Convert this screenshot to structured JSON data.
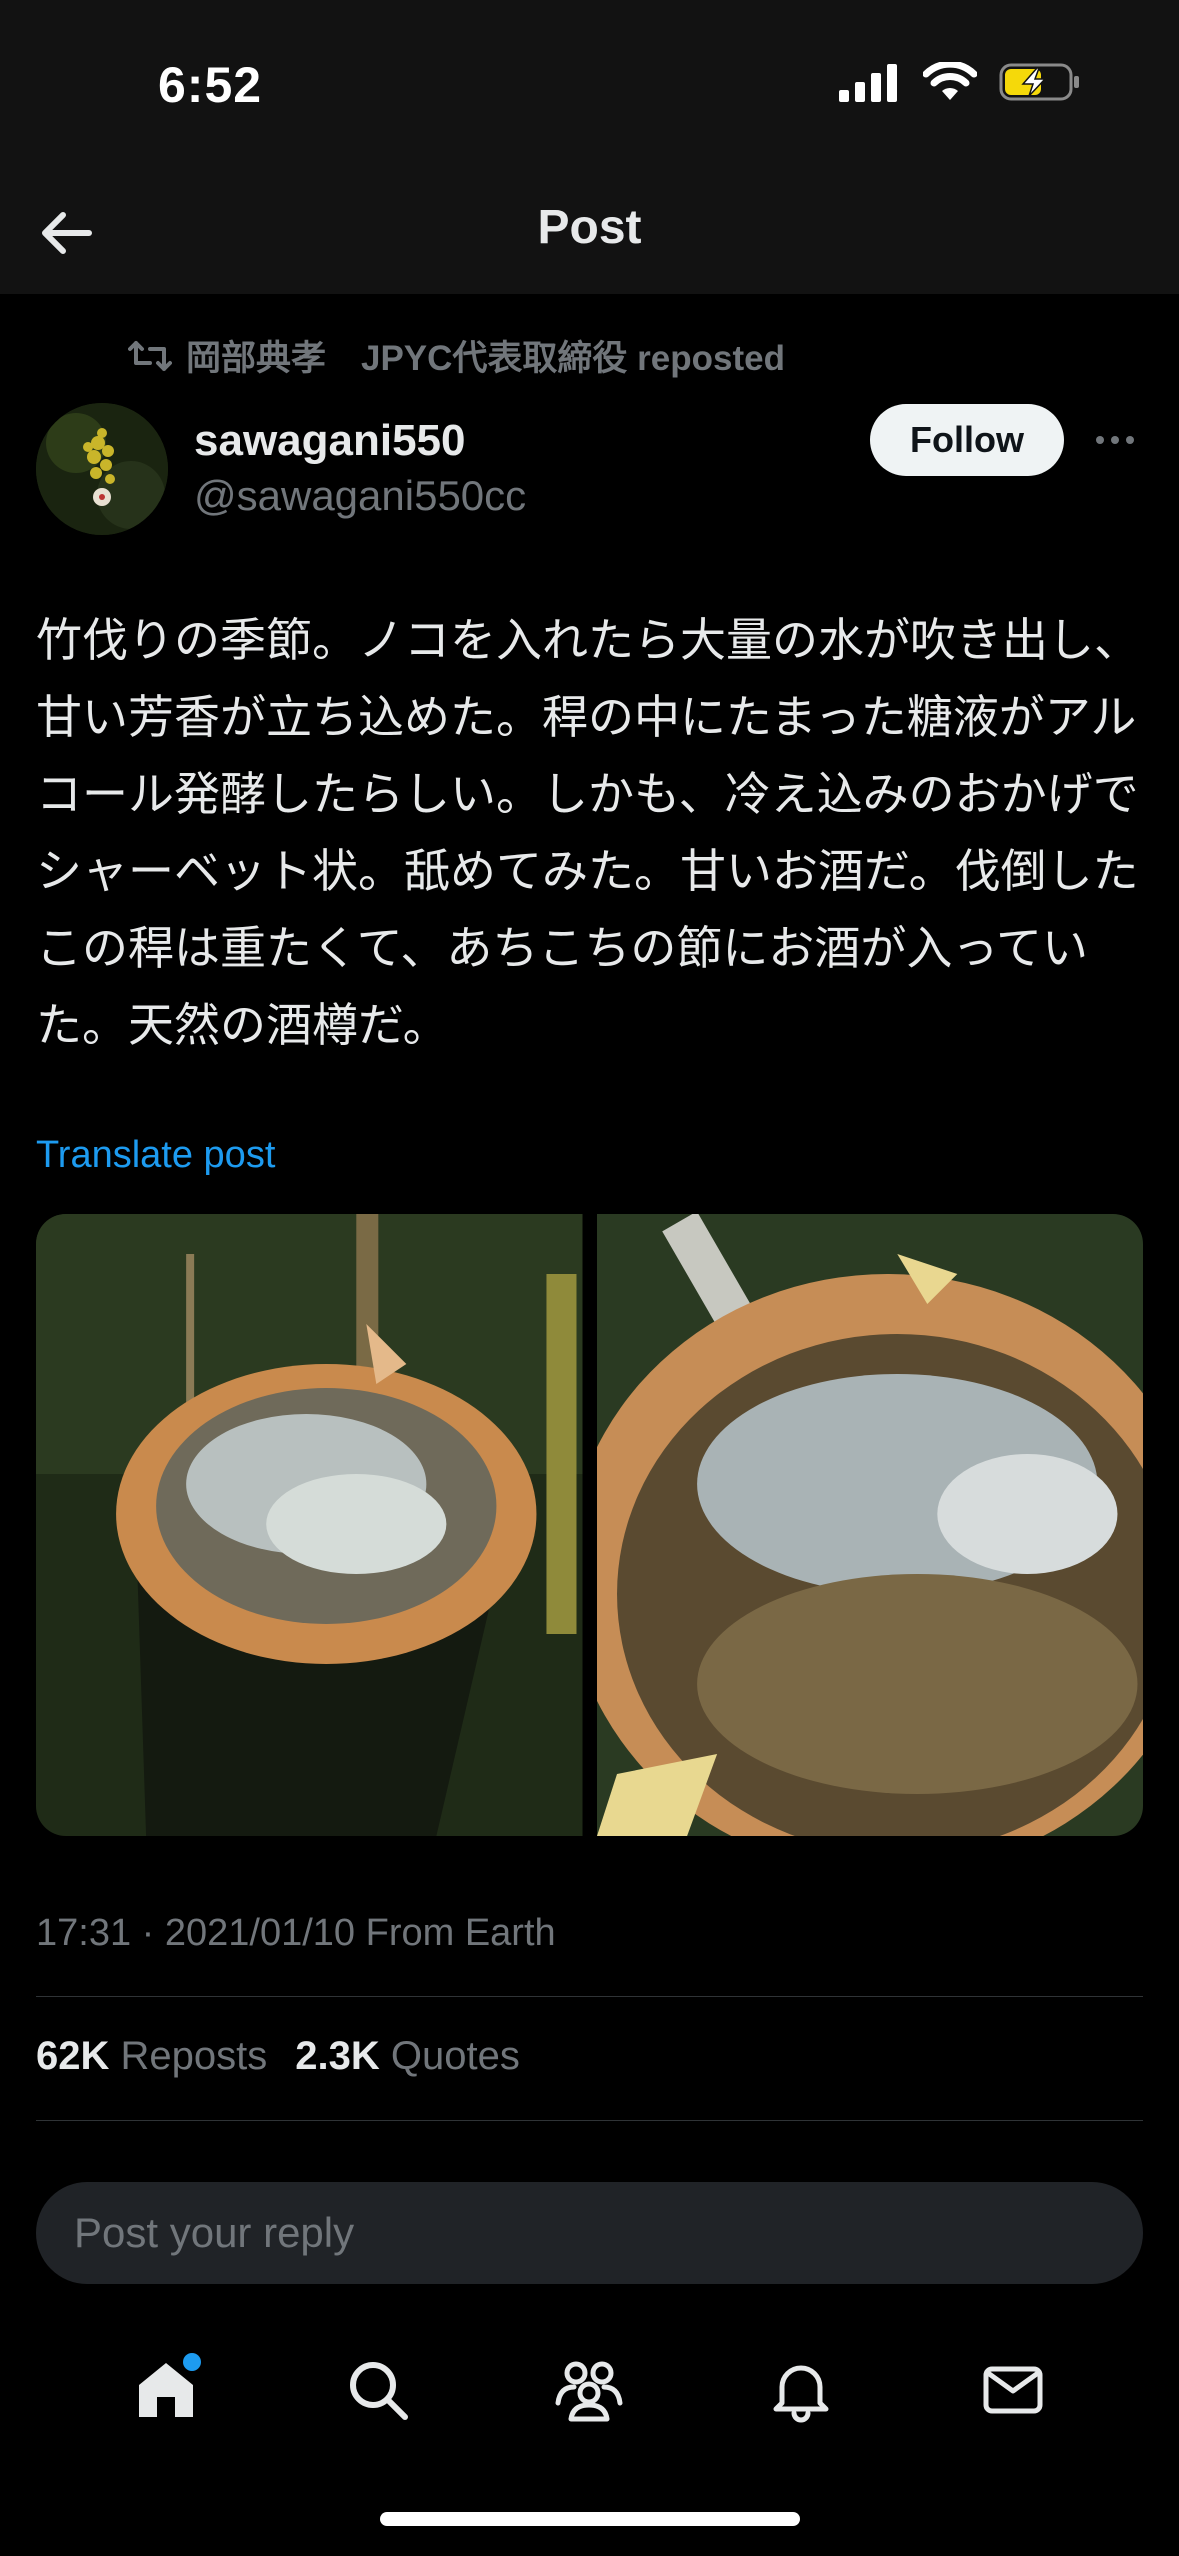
{
  "status_bar": {
    "time": "6:52"
  },
  "nav": {
    "title": "Post"
  },
  "repost": {
    "label": "岡部典孝　JPYC代表取締役 reposted"
  },
  "author": {
    "display_name": "sawagani550",
    "handle": "@sawagani550cc"
  },
  "follow": {
    "label": "Follow"
  },
  "post": {
    "text": "竹伐りの季節。ノコを入れたら大量の水が吹き出し、甘い芳香が立ち込めた。稈の中にたまった糖液がアルコール発酵したらしい。しかも、冷え込みのおかげでシャーベット状。舐めてみた。甘いお酒だ。伐倒したこの稈は重たくて、あちこちの節にお酒が入っていた。天然の酒樽だ。",
    "translate_label": "Translate post",
    "timestamp": "17:31 · 2021/01/10 From Earth"
  },
  "stats": {
    "reposts_count": "62K",
    "reposts_label": "Reposts",
    "quotes_count": "2.3K",
    "quotes_label": "Quotes"
  },
  "reply": {
    "placeholder": "Post your reply"
  },
  "tabbar": {
    "items": [
      "home-icon",
      "search-icon",
      "communities-icon",
      "notifications-icon",
      "messages-icon"
    ]
  },
  "colors": {
    "accent": "#1d9bf0",
    "background": "#000000",
    "muted": "#71767b"
  }
}
